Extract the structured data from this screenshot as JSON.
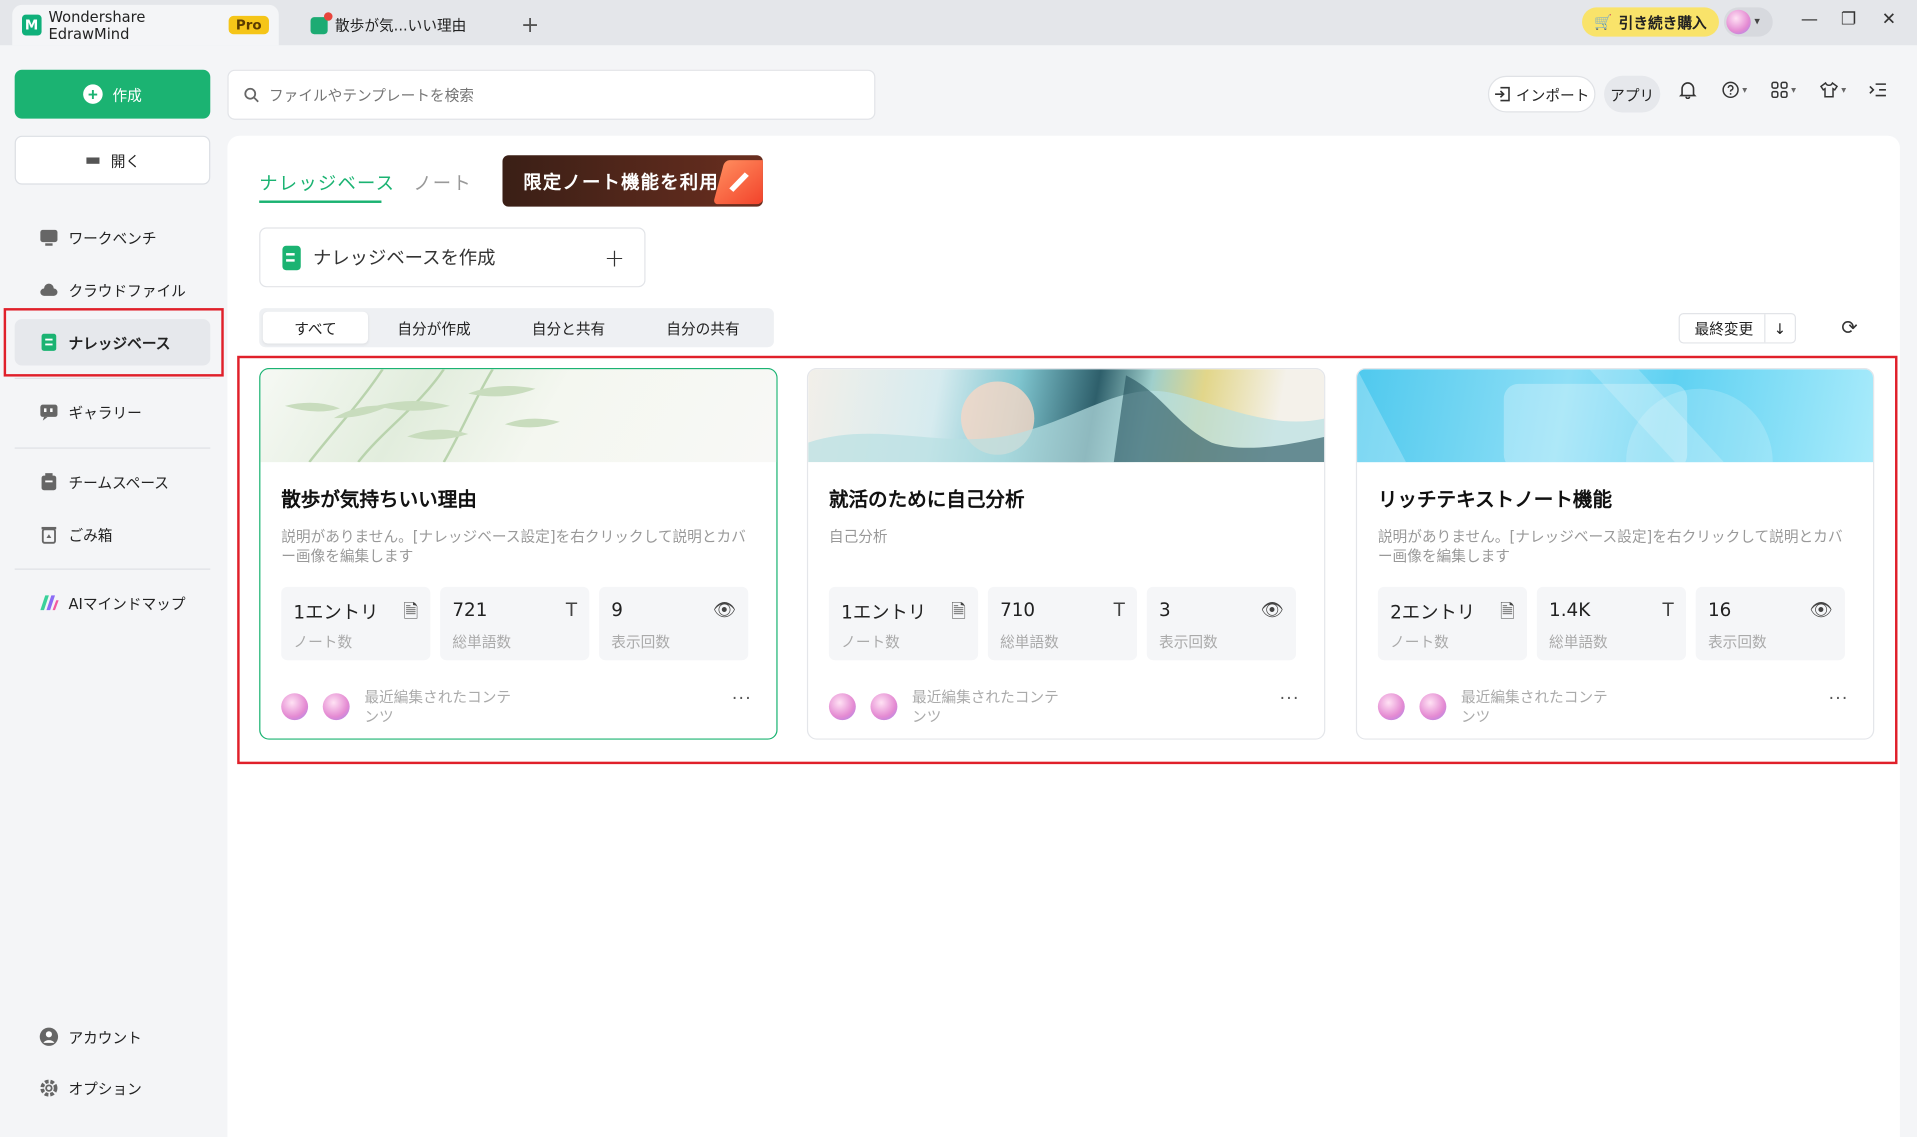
{
  "titlebar": {
    "app_name": "Wondershare EdrawMind",
    "pro_badge": "Pro",
    "doc_tab": "散歩が気...いい理由",
    "new_tab": "+",
    "buy_label": "引き続き購入"
  },
  "sidebar": {
    "create_label": "作成",
    "open_label": "開く",
    "items": [
      {
        "label": "ワークベンチ",
        "icon": "workbench-icon"
      },
      {
        "label": "クラウドファイル",
        "icon": "cloud-icon"
      },
      {
        "label": "ナレッジベース",
        "icon": "knowledge-base-icon"
      },
      {
        "label": "ギャラリー",
        "icon": "gallery-icon"
      },
      {
        "label": "チームスペース",
        "icon": "team-space-icon"
      },
      {
        "label": "ごみ箱",
        "icon": "trash-icon"
      },
      {
        "label": "AIマインドマップ",
        "icon": "ai-mindmap-icon"
      },
      {
        "label": "アカウント",
        "icon": "account-icon"
      },
      {
        "label": "オプション",
        "icon": "gear-icon"
      }
    ]
  },
  "toolbar": {
    "search_placeholder": "ファイルやテンプレートを検索",
    "import_label": "インポート",
    "app_label": "アプリ"
  },
  "main": {
    "tabs": [
      "ナレッジベース",
      "ノート"
    ],
    "promo_label": "限定ノート機能を利用",
    "create_kb_label": "ナレッジベースを作成",
    "filters": [
      "すべて",
      "自分が作成",
      "自分と共有",
      "自分の共有"
    ],
    "sort_label": "最終変更",
    "cards": [
      {
        "title": "散歩が気持ちいい理由",
        "desc": "説明がありません。[ナレッジベース設定]を右クリックして説明とカバー画像を編集します",
        "stats": [
          {
            "value": "1エントリ",
            "label": "ノート数"
          },
          {
            "value": "721",
            "label": "総単語数"
          },
          {
            "value": "9",
            "label": "表示回数"
          }
        ],
        "footer": "最近編集されたコンテンツ"
      },
      {
        "title": "就活のために自己分析",
        "desc": "自己分析",
        "stats": [
          {
            "value": "1エントリ",
            "label": "ノート数"
          },
          {
            "value": "710",
            "label": "総単語数"
          },
          {
            "value": "3",
            "label": "表示回数"
          }
        ],
        "footer": "最近編集されたコンテンツ"
      },
      {
        "title": "リッチテキストノート機能",
        "desc": "説明がありません。[ナレッジベース設定]を右クリックして説明とカバー画像を編集します",
        "stats": [
          {
            "value": "2エントリ",
            "label": "ノート数"
          },
          {
            "value": "1.4K",
            "label": "総単語数"
          },
          {
            "value": "16",
            "label": "表示回数"
          }
        ],
        "footer": "最近編集されたコンテンツ"
      }
    ]
  },
  "colors": {
    "accent": "#1bb372",
    "highlight_box": "#e0202a",
    "buy_button": "#f9e36a"
  }
}
